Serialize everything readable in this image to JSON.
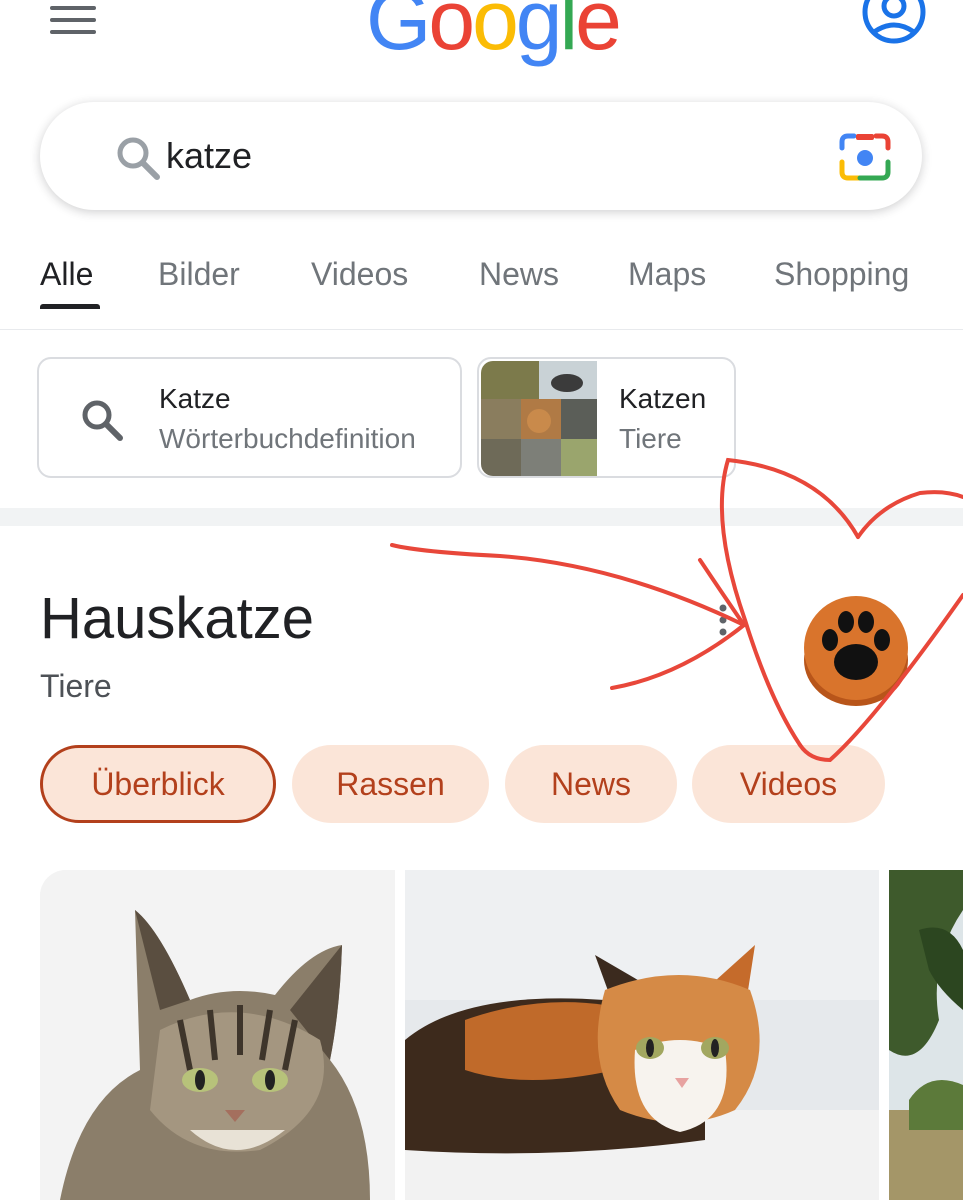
{
  "header": {
    "logo_letters": [
      {
        "char": "G",
        "color": "#4285F4"
      },
      {
        "char": "o",
        "color": "#EA4335"
      },
      {
        "char": "o",
        "color": "#FBBC05"
      },
      {
        "char": "g",
        "color": "#4285F4"
      },
      {
        "char": "l",
        "color": "#34A853"
      },
      {
        "char": "e",
        "color": "#EA4335"
      }
    ],
    "menu_icon": "hamburger-icon",
    "account_icon": "account-circle-icon"
  },
  "search": {
    "value": "katze",
    "search_icon": "search-icon",
    "lens_icon": "google-lens-icon"
  },
  "tabs": [
    {
      "label": "Alle",
      "active": true
    },
    {
      "label": "Bilder",
      "active": false
    },
    {
      "label": "Videos",
      "active": false
    },
    {
      "label": "News",
      "active": false
    },
    {
      "label": "Maps",
      "active": false
    },
    {
      "label": "Shopping",
      "active": false
    }
  ],
  "suggestions": [
    {
      "title": "Katze",
      "subtitle": "Wörterbuchdefinition",
      "icon": "search-icon"
    },
    {
      "title": "Katzen",
      "subtitle": "Tiere",
      "icon": "cat-collage-thumbnail"
    }
  ],
  "knowledge_panel": {
    "title": "Hauskatze",
    "subtitle": "Tiere",
    "more_icon": "more-vert-icon",
    "avatar_icon": "paw-icon",
    "pills": [
      {
        "label": "Überblick",
        "active": true
      },
      {
        "label": "Rassen",
        "active": false
      },
      {
        "label": "News",
        "active": false
      },
      {
        "label": "Videos",
        "active": false
      }
    ]
  },
  "images": [
    {
      "subject": "tabby-cat-photo"
    },
    {
      "subject": "calico-cat-photo"
    },
    {
      "subject": "tree-photo"
    }
  ],
  "colors": {
    "accent_text": "#b3401c",
    "pill_bg": "#fbe5d8",
    "annotation": "#e8473a",
    "paw_avatar": "#d2651f"
  }
}
